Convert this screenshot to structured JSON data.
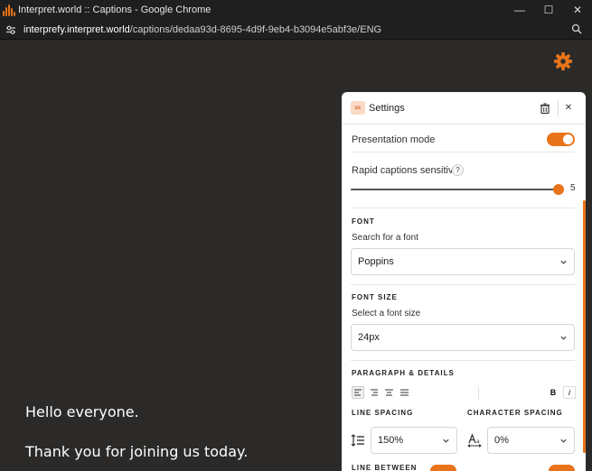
{
  "window": {
    "title": "Interpret.world :: Captions - Google Chrome",
    "minimize": "—",
    "maximize": "☐",
    "close": "✕"
  },
  "address": {
    "host": "interprefy.interpret.world",
    "path": "/captions/dedaa93d-8695-4d9f-9eb4-b3094e5abf3e/ENG"
  },
  "captions": [
    "Hello everyone.",
    "Thank you for joining us today."
  ],
  "settings": {
    "badge": "cc",
    "title": "Settings",
    "close": "✕",
    "presentation_mode": {
      "label": "Presentation mode",
      "on": true
    },
    "sensitivity": {
      "label": "Rapid captions sensitivity",
      "help": "?",
      "value": "5",
      "max": 5
    },
    "font": {
      "section": "FONT",
      "label": "Search for a font",
      "value": "Poppins"
    },
    "font_size": {
      "section": "FONT SIZE",
      "label": "Select a font size",
      "value": "24px"
    },
    "paragraph": {
      "section": "PARAGRAPH & DETAILS",
      "bold": "B",
      "italic": "i"
    },
    "line_spacing": {
      "section": "LINE SPACING",
      "value": "150%"
    },
    "char_spacing": {
      "section": "CHARACTER SPACING",
      "value": "0%"
    },
    "next_section": "LINE BETWEEN"
  },
  "colors": {
    "accent": "#e8731a",
    "page_bg": "#2b2a29",
    "chrome_bg": "#1f1f1f"
  }
}
